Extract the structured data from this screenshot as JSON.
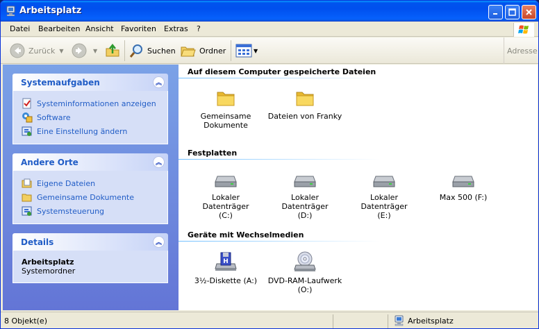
{
  "window": {
    "title": "Arbeitsplatz"
  },
  "menu": [
    "Datei",
    "Bearbeiten",
    "Ansicht",
    "Favoriten",
    "Extras",
    "?"
  ],
  "toolbar": {
    "back": "Zurück",
    "search": "Suchen",
    "folders": "Ordner",
    "address": "Adresse"
  },
  "left": {
    "system": {
      "title": "Systemaufgaben",
      "items": [
        "Systeminformationen anzeigen",
        "Software",
        "Eine Einstellung ändern"
      ]
    },
    "places": {
      "title": "Andere Orte",
      "items": [
        "Eigene Dateien",
        "Gemeinsame Dokumente",
        "Systemsteuerung"
      ]
    },
    "details": {
      "title": "Details",
      "name": "Arbeitsplatz",
      "type": "Systemordner"
    }
  },
  "groups": {
    "stored": {
      "title": "Auf diesem Computer gespeicherte Dateien",
      "items": [
        {
          "label1": "Gemeinsame",
          "label2": "Dokumente"
        },
        {
          "label1": "Dateien von Franky",
          "label2": ""
        }
      ]
    },
    "disks": {
      "title": "Festplatten",
      "items": [
        {
          "label1": "Lokaler Datenträger",
          "label2": "(C:)"
        },
        {
          "label1": "Lokaler Datenträger",
          "label2": "(D:)"
        },
        {
          "label1": "Lokaler Datenträger",
          "label2": "(E:)"
        },
        {
          "label1": "Max 500 (F:)",
          "label2": ""
        }
      ]
    },
    "removable": {
      "title": "Geräte mit Wechselmedien",
      "items": [
        {
          "label1": "3½-Diskette (A:)",
          "label2": ""
        },
        {
          "label1": "DVD-RAM-Laufwerk",
          "label2": "(O:)"
        }
      ]
    }
  },
  "status": {
    "count": "8 Objekt(e)",
    "location": "Arbeitsplatz"
  },
  "colors": {
    "link": "#215dc6",
    "titlebar": "#0053ee"
  }
}
